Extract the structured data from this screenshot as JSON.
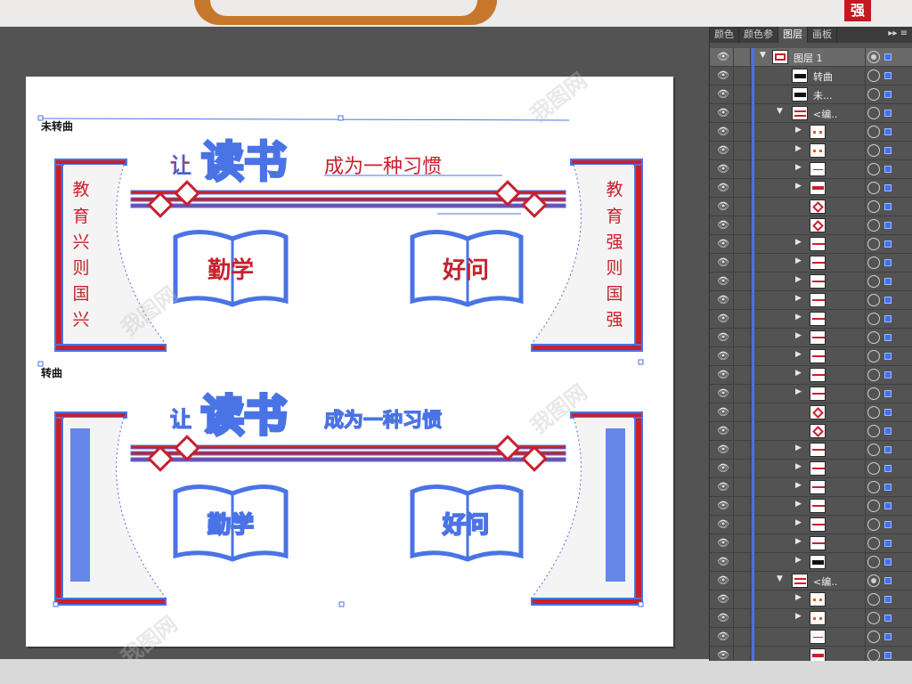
{
  "app": {
    "top_red_mark": "强"
  },
  "panel": {
    "tabs": [
      "颜色",
      "颜色参",
      "图层",
      "画板"
    ],
    "active_tab": "图层",
    "layers": [
      {
        "name": "图层 1",
        "indent": 0,
        "tri": "▼",
        "type": "layer",
        "filled": true
      },
      {
        "name": "转曲",
        "indent": 1,
        "tri": "",
        "type": "text"
      },
      {
        "name": "未...",
        "indent": 1,
        "tri": "",
        "type": "text"
      },
      {
        "name": "<编..",
        "indent": 1,
        "tri": "▼",
        "type": "group"
      },
      {
        "name": "",
        "indent": 2,
        "tri": "▶",
        "type": "dots"
      },
      {
        "name": "",
        "indent": 2,
        "tri": "▶",
        "type": "dots"
      },
      {
        "name": "",
        "indent": 2,
        "tri": "▶",
        "type": "line"
      },
      {
        "name": "",
        "indent": 2,
        "tri": "▶",
        "type": "title"
      },
      {
        "name": "",
        "indent": 2,
        "tri": "",
        "type": "diamond"
      },
      {
        "name": "",
        "indent": 2,
        "tri": "",
        "type": "diamond"
      },
      {
        "name": "",
        "indent": 2,
        "tri": "▶",
        "type": "bar"
      },
      {
        "name": "",
        "indent": 2,
        "tri": "▶",
        "type": "bar"
      },
      {
        "name": "",
        "indent": 2,
        "tri": "▶",
        "type": "bar"
      },
      {
        "name": "",
        "indent": 2,
        "tri": "▶",
        "type": "bar"
      },
      {
        "name": "",
        "indent": 2,
        "tri": "▶",
        "type": "bar"
      },
      {
        "name": "",
        "indent": 2,
        "tri": "▶",
        "type": "bar"
      },
      {
        "name": "",
        "indent": 2,
        "tri": "▶",
        "type": "bar"
      },
      {
        "name": "",
        "indent": 2,
        "tri": "▶",
        "type": "bar"
      },
      {
        "name": "",
        "indent": 2,
        "tri": "▶",
        "type": "bar"
      },
      {
        "name": "",
        "indent": 2,
        "tri": "",
        "type": "diamond"
      },
      {
        "name": "",
        "indent": 2,
        "tri": "",
        "type": "diamond"
      },
      {
        "name": "",
        "indent": 2,
        "tri": "▶",
        "type": "bar"
      },
      {
        "name": "",
        "indent": 2,
        "tri": "▶",
        "type": "bar"
      },
      {
        "name": "",
        "indent": 2,
        "tri": "▶",
        "type": "bar"
      },
      {
        "name": "",
        "indent": 2,
        "tri": "▶",
        "type": "bar"
      },
      {
        "name": "",
        "indent": 2,
        "tri": "▶",
        "type": "bar"
      },
      {
        "name": "",
        "indent": 2,
        "tri": "▶",
        "type": "bar"
      },
      {
        "name": "",
        "indent": 2,
        "tri": "▶",
        "type": "text"
      },
      {
        "name": "<编..",
        "indent": 1,
        "tri": "▼",
        "type": "group",
        "filled": true
      },
      {
        "name": "",
        "indent": 2,
        "tri": "▶",
        "type": "dots"
      },
      {
        "name": "",
        "indent": 2,
        "tri": "▶",
        "type": "dots"
      },
      {
        "name": "",
        "indent": 2,
        "tri": "",
        "type": "line"
      },
      {
        "name": "",
        "indent": 2,
        "tri": "",
        "type": "title"
      }
    ]
  },
  "artboard": {
    "label_top": "未转曲",
    "label_bottom": "转曲",
    "title_prefix": "让",
    "title_main": "读书",
    "title_suffix": "成为一种习惯",
    "left_column": [
      "教",
      "育",
      "兴",
      "则",
      "国",
      "兴"
    ],
    "right_column": [
      "教",
      "育",
      "强",
      "则",
      "国",
      "强"
    ],
    "book_left": "勤学",
    "book_right": "好问"
  },
  "watermark": "我图网"
}
